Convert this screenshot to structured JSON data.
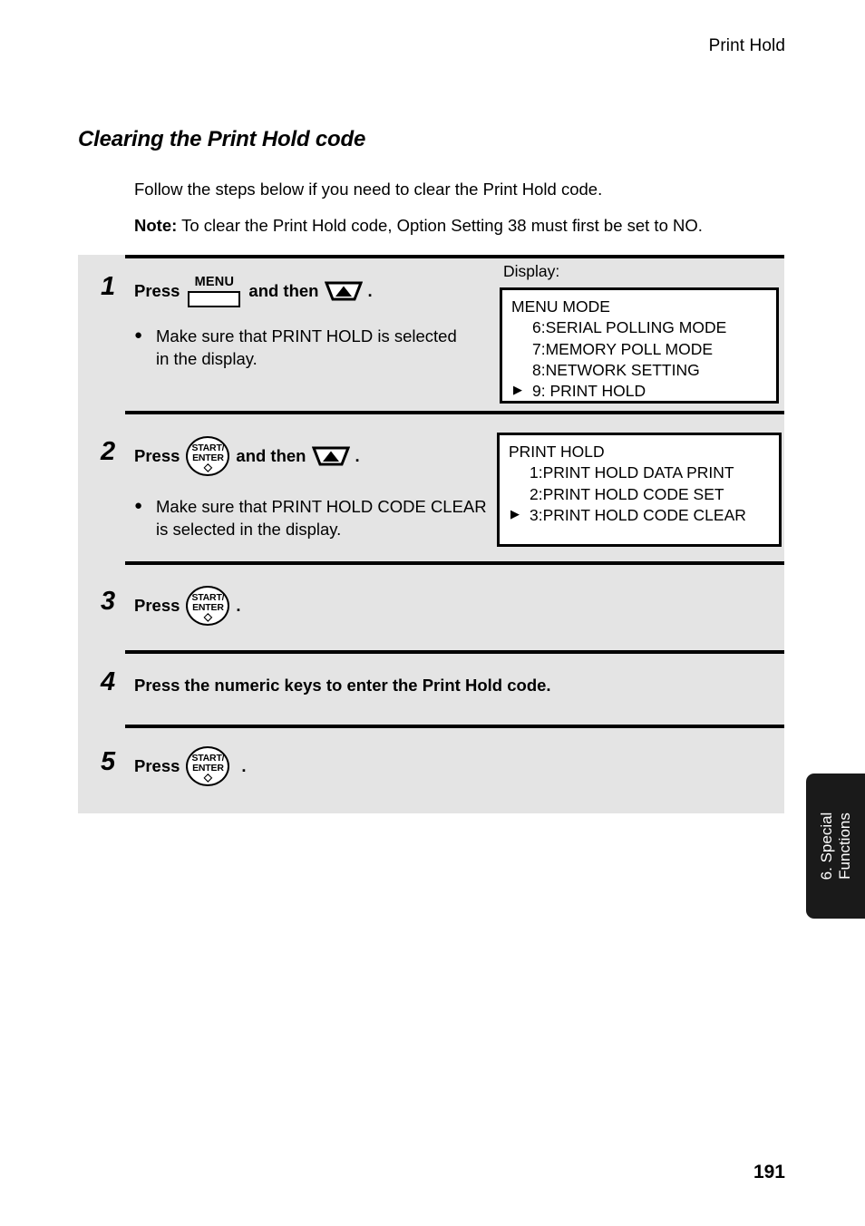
{
  "header": {
    "running_head": "Print Hold"
  },
  "section": {
    "title": "Clearing the Print Hold code",
    "intro": "Follow the steps below if you need to clear the Print Hold code.",
    "note_label": "Note:",
    "note_text": "To clear the Print Hold code, Option Setting 38 must first be set to NO."
  },
  "display_column": {
    "label": "Display:"
  },
  "keys": {
    "menu": {
      "label": "MENU",
      "icon": "menu-key-icon"
    },
    "start_enter": {
      "line1": "START/",
      "line2": "ENTER",
      "symbol": "◇",
      "icon": "start-enter-key-icon"
    },
    "up_arrow": {
      "icon": "up-arrow-key-icon"
    }
  },
  "steps": [
    {
      "number": "1",
      "press_word": "Press",
      "and_then": "and then",
      "trailing": ".",
      "bullet": "Make sure that PRINT HOLD is selected in the display.",
      "lcd": {
        "rows": [
          {
            "text": "MENU MODE",
            "indent": false,
            "marker": ""
          },
          {
            "text": "6:SERIAL POLLING MODE",
            "indent": true,
            "marker": ""
          },
          {
            "text": "7:MEMORY POLL MODE",
            "indent": true,
            "marker": ""
          },
          {
            "text": "8:NETWORK SETTING",
            "indent": true,
            "marker": ""
          },
          {
            "text": "9: PRINT HOLD",
            "indent": true,
            "marker": "▶"
          }
        ]
      }
    },
    {
      "number": "2",
      "press_word": "Press",
      "and_then": "and then",
      "trailing": ".",
      "bullet": "Make sure that PRINT HOLD CODE CLEAR is selected in the display.",
      "lcd": {
        "rows": [
          {
            "text": "PRINT HOLD",
            "indent": false,
            "marker": ""
          },
          {
            "text": "1:PRINT HOLD DATA PRINT",
            "indent": true,
            "marker": ""
          },
          {
            "text": "2:PRINT HOLD CODE SET",
            "indent": true,
            "marker": ""
          },
          {
            "text": "3:PRINT HOLD CODE CLEAR",
            "indent": true,
            "marker": "▶"
          }
        ]
      }
    },
    {
      "number": "3",
      "press_word": "Press",
      "trailing": "."
    },
    {
      "number": "4",
      "instruction": "Press the numeric keys to enter the Print Hold code."
    },
    {
      "number": "5",
      "press_word": "Press",
      "trailing": "."
    }
  ],
  "side_tab": {
    "line1": "6. Special",
    "line2": "Functions"
  },
  "footer": {
    "page_number": "191"
  },
  "colors": {
    "panel_background": "#e4e4e4",
    "rule": "#000000",
    "tab_background": "#1a1a1a",
    "tab_text": "#ffffff",
    "page_background": "#ffffff"
  }
}
